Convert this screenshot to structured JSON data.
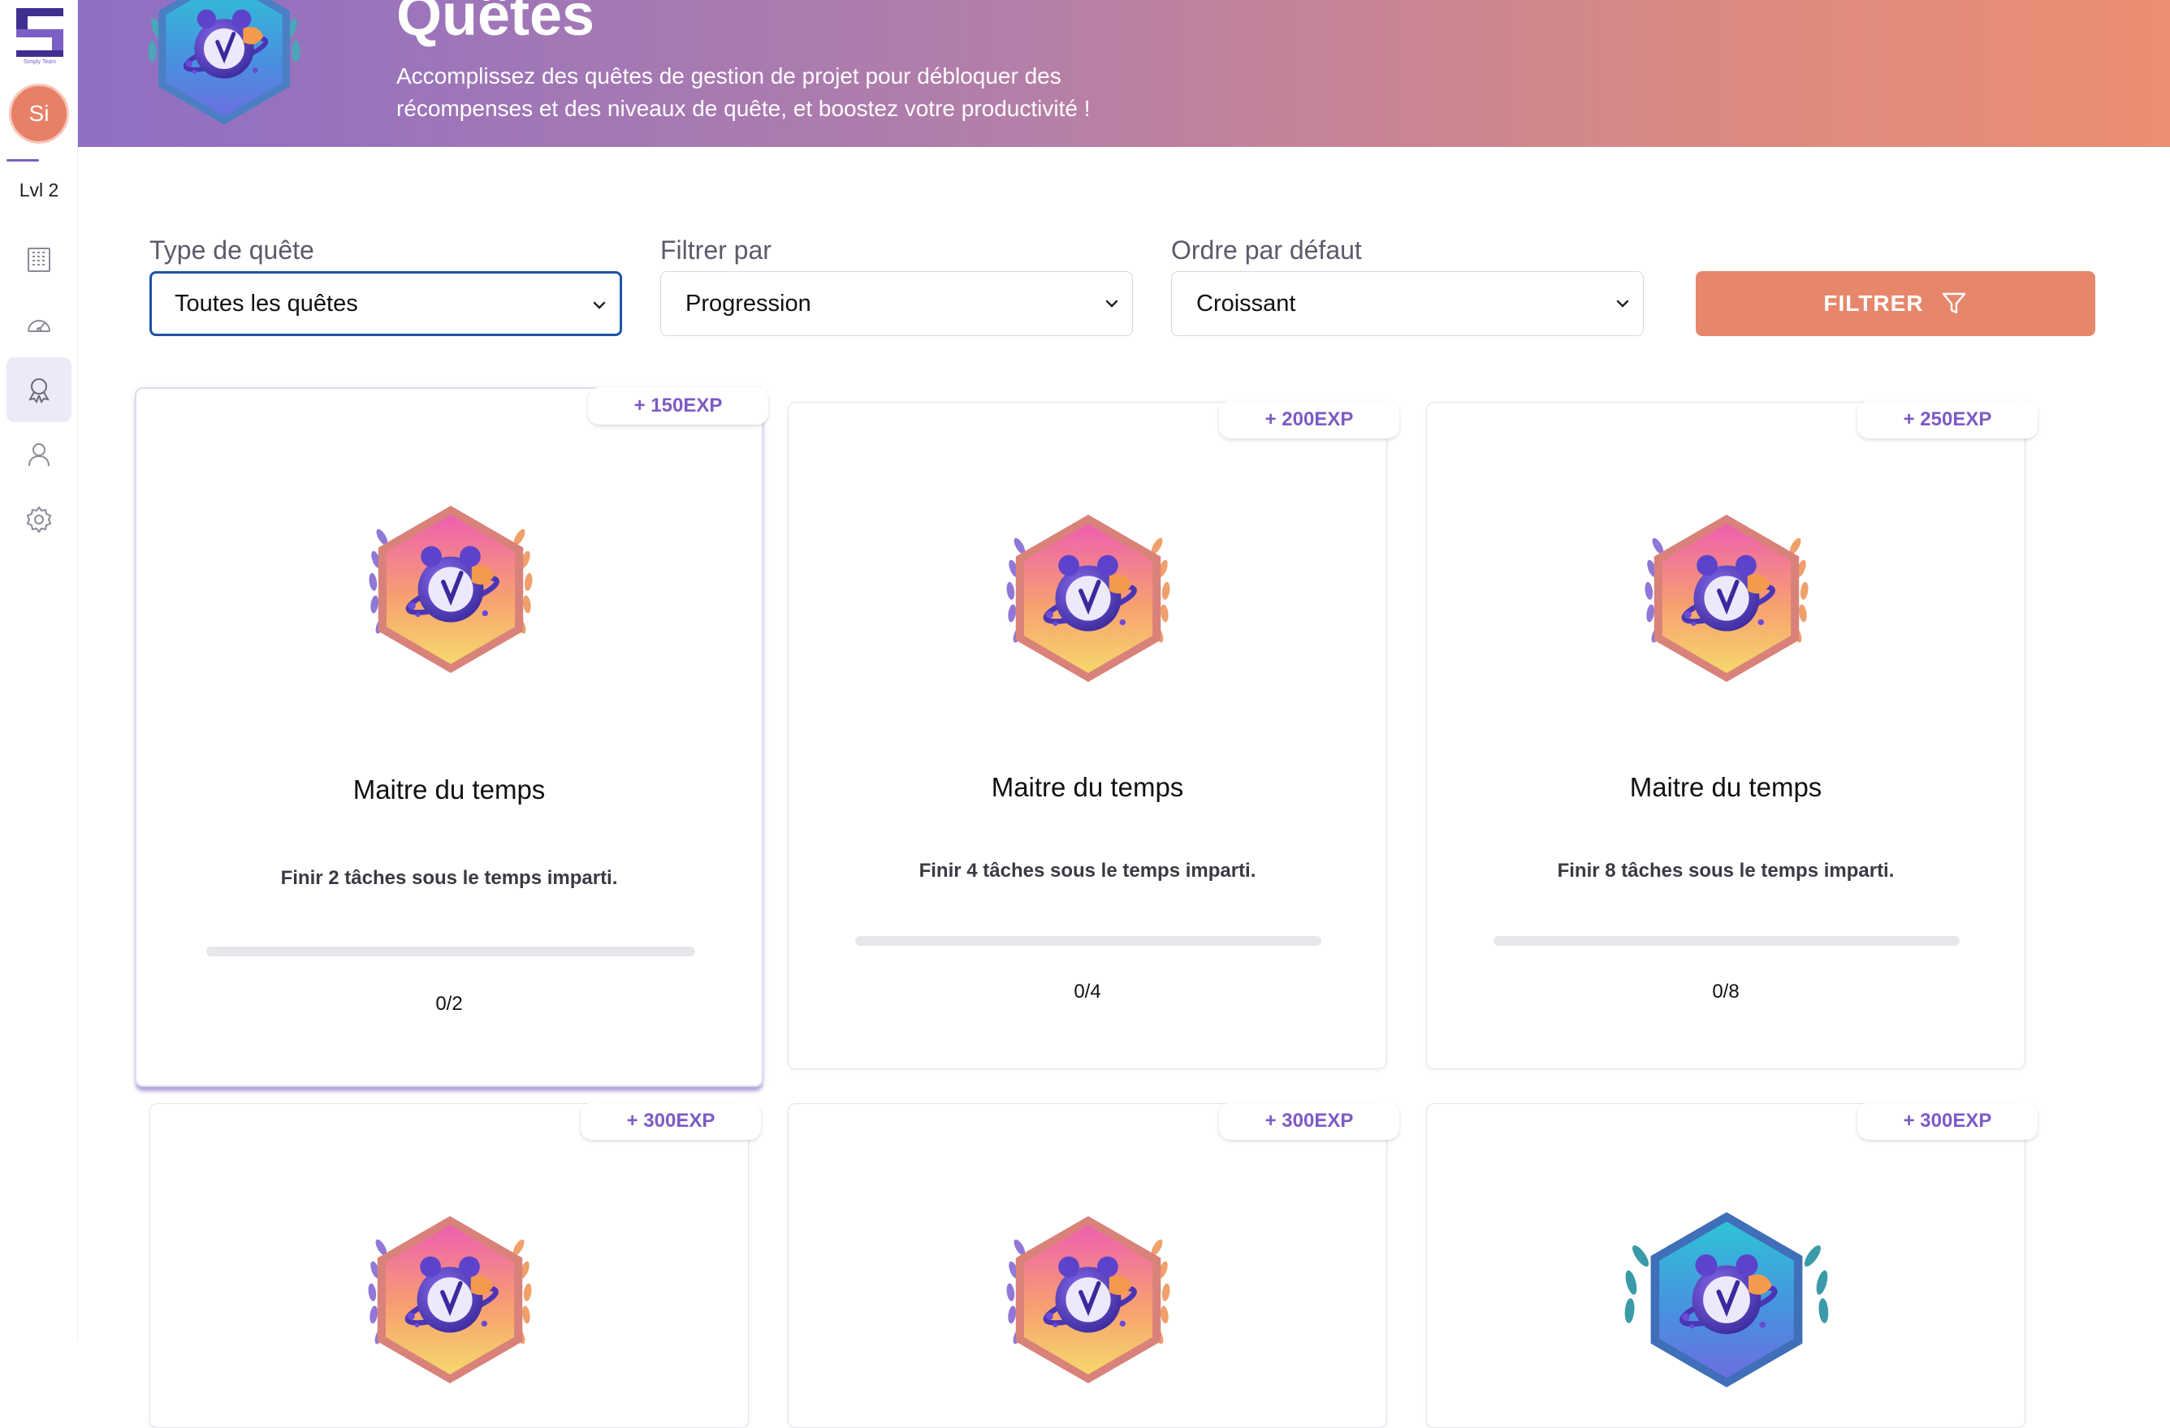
{
  "app": {
    "logo_caption": "Simply Team",
    "avatar_initials": "Si",
    "level_label": "Lvl 2"
  },
  "sidebar": {
    "items": [
      {
        "name": "dashboard",
        "icon": "building-grid-icon"
      },
      {
        "name": "performance",
        "icon": "speedometer-icon"
      },
      {
        "name": "quests",
        "icon": "award-icon",
        "active": true
      },
      {
        "name": "profile",
        "icon": "user-icon"
      },
      {
        "name": "settings",
        "icon": "gear-icon"
      }
    ]
  },
  "header": {
    "title": "Quêtes",
    "subtitle_line1": "Accomplissez des quêtes de gestion de projet pour débloquer des",
    "subtitle_line2": "récompenses et des niveaux de quête, et boostez votre productivité !"
  },
  "filters": {
    "type_label": "Type de quête",
    "type_value": "Toutes les quêtes",
    "filter_label": "Filtrer par",
    "filter_value": "Progression",
    "order_label": "Ordre par défaut",
    "order_value": "Croissant",
    "button_label": "FILTRER"
  },
  "quests": [
    {
      "exp": "+ 150EXP",
      "title": "Maitre du temps",
      "description": "Finir 2 tâches sous le temps imparti.",
      "count": "0/2",
      "progress": 0
    },
    {
      "exp": "+ 200EXP",
      "title": "Maitre du temps",
      "description": "Finir 4 tâches sous le temps imparti.",
      "count": "0/4",
      "progress": 0
    },
    {
      "exp": "+ 250EXP",
      "title": "Maitre du temps",
      "description": "Finir 8 tâches sous le temps imparti.",
      "count": "0/8",
      "progress": 0
    },
    {
      "exp": "+ 300EXP"
    },
    {
      "exp": "+ 300EXP"
    },
    {
      "exp": "+ 300EXP"
    }
  ],
  "colors": {
    "accent": "#7b5fc4",
    "button": "#e6876b",
    "focus": "#1f53a9"
  }
}
